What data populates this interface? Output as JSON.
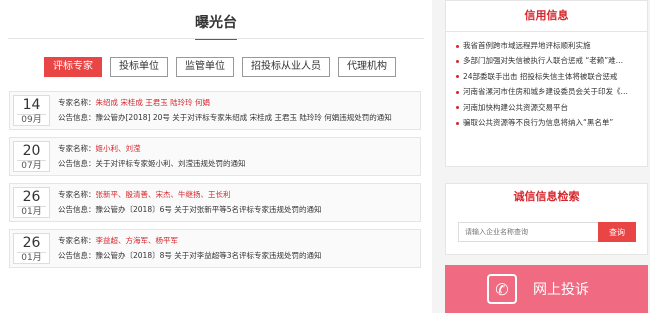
{
  "section": {
    "title": "曝光台"
  },
  "tabs": [
    {
      "label": "评标专家",
      "active": true
    },
    {
      "label": "投标单位",
      "active": false
    },
    {
      "label": "监管单位",
      "active": false
    },
    {
      "label": "招投标从业人员",
      "active": false
    },
    {
      "label": "代理机构",
      "active": false
    }
  ],
  "records": [
    {
      "day": "14",
      "month": "09月",
      "expert_label": "专家名称：",
      "experts": "朱绍成 宋桂成 王君玉 陆玲玲 何娟",
      "notice_label": "公告信息：",
      "notice": "豫公管办[2018] 20号 关于对评标专家朱绍成 宋桂成 王君玉 陆玲玲 何娟违规处罚的通知"
    },
    {
      "day": "20",
      "month": "07月",
      "expert_label": "专家名称：",
      "experts": "姬小利、刘滢",
      "notice_label": "公告信息：",
      "notice": "关于对评标专家姬小利、刘滢违规处罚的通知"
    },
    {
      "day": "26",
      "month": "01月",
      "expert_label": "专家名称：",
      "experts": "张新平、殷清善、宋杰、牛继扬、王长利",
      "notice_label": "公告信息：",
      "notice": "豫公管办〔2018〕6号 关于对张新平等5名评标专家违规处罚的通知"
    },
    {
      "day": "26",
      "month": "01月",
      "expert_label": "专家名称：",
      "experts": "李益超、方海军、杨平军",
      "notice_label": "公告信息：",
      "notice": "豫公管办〔2018〕8号 关于对李益超等3名评标专家违规处罚的通知"
    }
  ],
  "credit": {
    "title": "信用信息",
    "items": [
      "我省首例跨市域远程异地评标顺利实施",
      "多部门加强对失信被执行人联合惩戒 “老赖”难…",
      "24部委联手出击 招投标失信主体将被联合惩戒",
      "河南省漯河市住房和城乡建设委员会关于印发《…",
      "河南加快构建公共资源交易平台",
      "骗取公共资源等不良行为信息将纳入“黑名单”"
    ]
  },
  "search": {
    "title": "诚信信息检索",
    "placeholder": "请输入企业名称查询",
    "button": "查询"
  },
  "complain": {
    "label": "网上投诉"
  },
  "colors": {
    "accent": "#d7262c",
    "tab_active": "#e94545",
    "complain_bg": "#f06b82"
  }
}
